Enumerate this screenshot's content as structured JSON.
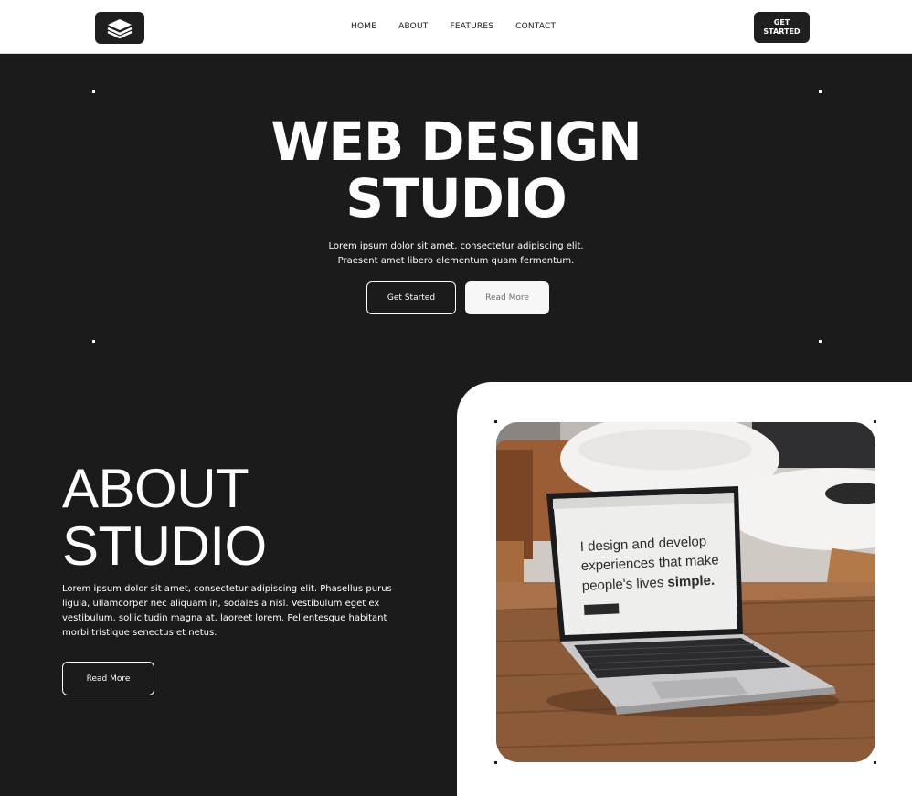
{
  "header": {
    "logo_icon": "layers-icon",
    "nav": [
      "HOME",
      "ABOUT",
      "FEATURES",
      "CONTACT"
    ],
    "cta_label": "GET STARTED"
  },
  "hero": {
    "title_line1": "WEB DESIGN",
    "title_line2": "STUDIO",
    "subtitle_line1": "Lorem ipsum dolor sit amet, consectetur adipiscing elit.",
    "subtitle_line2": "Praesent amet libero elementum quam fermentum.",
    "primary_button": "Get Started",
    "secondary_button": "Read More"
  },
  "about": {
    "title_line1": "ABOUT",
    "title_line2": "STUDIO",
    "body": "Lorem ipsum dolor sit amet, consectetur adipiscing elit. Phasellus purus ligula, ullamcorper nec aliquam in, sodales a nisl. Vestibulum eget ex vestibulum, sollicitudin magna at, laoreet lorem. Pellentesque habitant morbi tristique senectus et netus.",
    "button": "Read More"
  },
  "photo": {
    "screen_text_line1": "I design and develop",
    "screen_text_line2": "experiences that make",
    "screen_text_line3a": "people's lives ",
    "screen_text_line3b": "simple."
  },
  "colors": {
    "background": "#1c1b1b",
    "header_bg": "#ffffff",
    "accent_dark": "#1f1f1f",
    "text_light": "#ffffff"
  }
}
